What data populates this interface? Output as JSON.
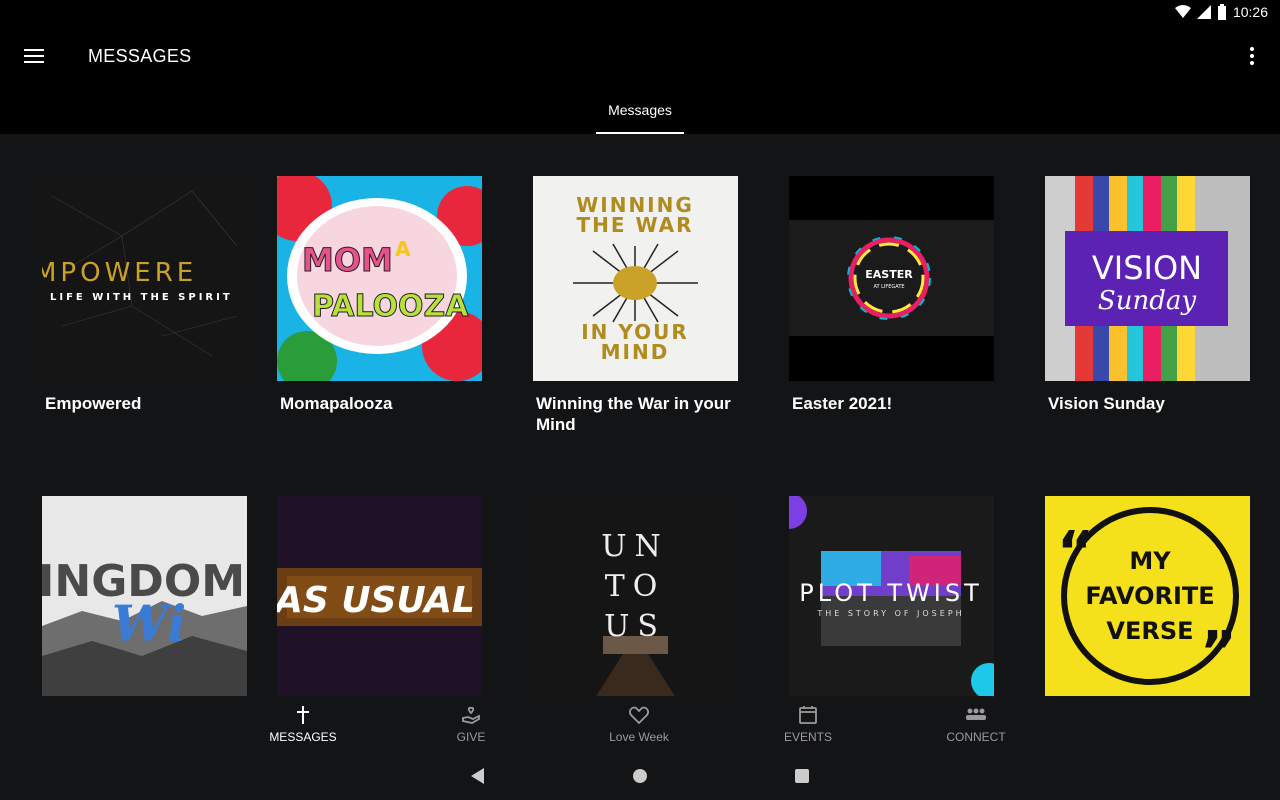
{
  "status_bar": {
    "time": "10:26"
  },
  "app_bar": {
    "title": "MESSAGES"
  },
  "tabs": [
    {
      "label": "Messages"
    }
  ],
  "series": [
    {
      "title": "Empowered",
      "art_lines": [
        "MPOWERE",
        "LIFE WITH THE SPIRIT"
      ]
    },
    {
      "title": "Momapalooza",
      "art_lines": [
        "MOM",
        "A",
        "PALOOZA"
      ]
    },
    {
      "title": "Winning the War in your Mind",
      "art_lines": [
        "WINNING",
        "THE WAR",
        "IN YOUR",
        "MIND"
      ]
    },
    {
      "title": "Easter 2021!",
      "art_lines": [
        "EASTER",
        "AT LIFEGATE"
      ]
    },
    {
      "title": "Vision Sunday",
      "art_lines": [
        "VISION",
        "Sunday"
      ]
    },
    {
      "title": "",
      "art_lines": [
        "INGDOM",
        "Wi"
      ]
    },
    {
      "title": "",
      "art_lines": [
        "AS USUAL"
      ]
    },
    {
      "title": "",
      "art_lines": [
        "UN",
        "TO",
        "US"
      ]
    },
    {
      "title": "",
      "art_lines": [
        "PLOT TWIST",
        "THE STORY OF JOSEPH"
      ]
    },
    {
      "title": "",
      "art_lines": [
        "MY",
        "FAVORITE",
        "VERSE"
      ]
    }
  ],
  "bottom_nav": [
    {
      "label": "MESSAGES",
      "icon": "cross-icon",
      "active": true
    },
    {
      "label": "GIVE",
      "icon": "give-hand-icon",
      "active": false
    },
    {
      "label": "Love Week",
      "icon": "heart-icon",
      "active": false
    },
    {
      "label": "EVENTS",
      "icon": "calendar-icon",
      "active": false
    },
    {
      "label": "CONNECT",
      "icon": "people-icon",
      "active": false
    }
  ]
}
